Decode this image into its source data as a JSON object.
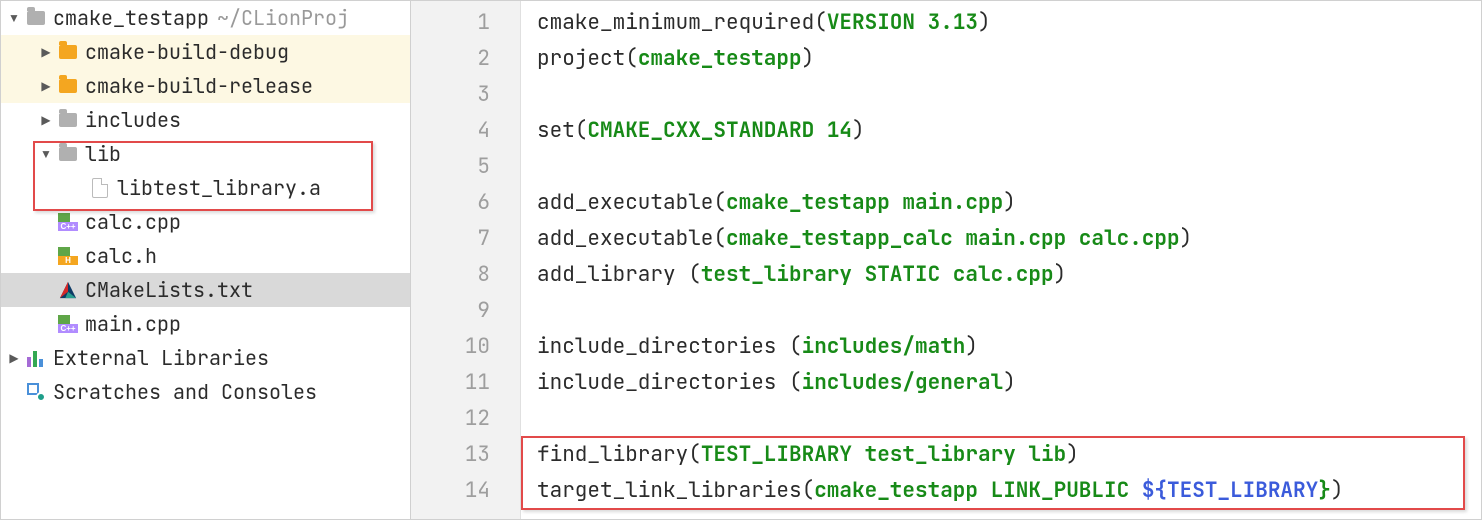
{
  "tree": {
    "root": {
      "label": "cmake_testapp",
      "aux": "~/CLionProj"
    },
    "build_debug": "cmake-build-debug",
    "build_release": "cmake-build-release",
    "includes": "includes",
    "lib": "lib",
    "lib_file": "libtest_library.a",
    "calc_cpp": "calc.cpp",
    "calc_h": "calc.h",
    "cmakelists": "CMakeLists.txt",
    "main_cpp": "main.cpp",
    "ext_libs": "External Libraries",
    "scratches": "Scratches and Consoles"
  },
  "editor": {
    "line_numbers": [
      "1",
      "2",
      "3",
      "4",
      "5",
      "6",
      "7",
      "8",
      "9",
      "10",
      "11",
      "12",
      "13",
      "14"
    ],
    "lines": [
      [
        {
          "t": "cmake_minimum_required("
        },
        {
          "t": "VERSION 3.13",
          "c": "kw"
        },
        {
          "t": ")"
        }
      ],
      [
        {
          "t": "project("
        },
        {
          "t": "cmake_testapp",
          "c": "kw"
        },
        {
          "t": ")"
        }
      ],
      [
        {
          "t": ""
        }
      ],
      [
        {
          "t": "set("
        },
        {
          "t": "CMAKE_CXX_STANDARD 14",
          "c": "kw"
        },
        {
          "t": ")"
        }
      ],
      [
        {
          "t": ""
        }
      ],
      [
        {
          "t": "add_executable("
        },
        {
          "t": "cmake_testapp main.cpp",
          "c": "kw"
        },
        {
          "t": ")"
        }
      ],
      [
        {
          "t": "add_executable("
        },
        {
          "t": "cmake_testapp_calc main.cpp calc.cpp",
          "c": "kw"
        },
        {
          "t": ")"
        }
      ],
      [
        {
          "t": "add_library ("
        },
        {
          "t": "test_library STATIC calc.cpp",
          "c": "kw"
        },
        {
          "t": ")"
        }
      ],
      [
        {
          "t": ""
        }
      ],
      [
        {
          "t": "include_directories ("
        },
        {
          "t": "includes/math",
          "c": "kw"
        },
        {
          "t": ")"
        }
      ],
      [
        {
          "t": "include_directories ("
        },
        {
          "t": "includes/general",
          "c": "kw"
        },
        {
          "t": ")"
        }
      ],
      [
        {
          "t": ""
        }
      ],
      [
        {
          "t": "find_library("
        },
        {
          "t": "TEST_LIBRARY test_library lib",
          "c": "kw"
        },
        {
          "t": ")"
        }
      ],
      [
        {
          "t": "target_link_libraries("
        },
        {
          "t": "cmake_testapp LINK_PUBLIC ",
          "c": "kw"
        },
        {
          "t": "${",
          "c": "var"
        },
        {
          "t": "TEST_LIBRARY",
          "c": "var"
        },
        {
          "t": "}",
          "c": "brace"
        },
        {
          "t": ")"
        }
      ]
    ]
  }
}
